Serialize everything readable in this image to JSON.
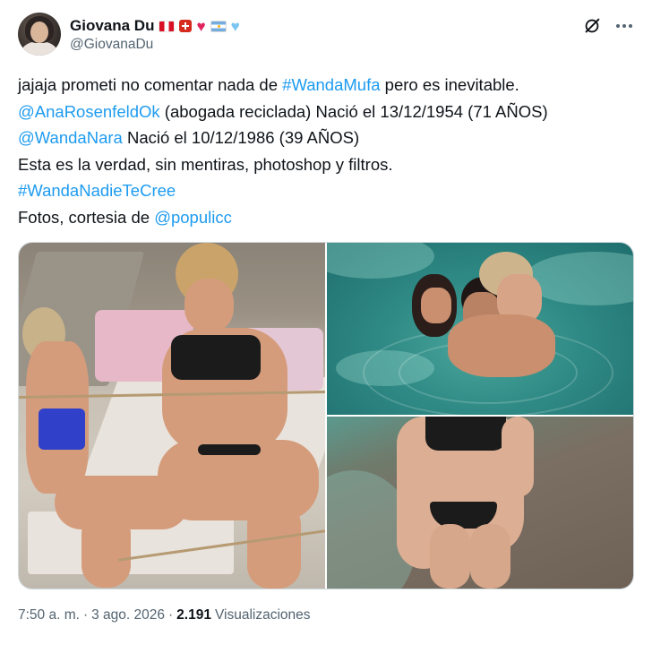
{
  "author": {
    "display_name": "Giovana Du",
    "handle": "@GiovanaDu",
    "name_emojis": [
      "flag-peru",
      "flag-switzerland",
      "red-heart",
      "flag-argentina",
      "light-blue-heart"
    ]
  },
  "tweet": {
    "lines": [
      {
        "parts": [
          {
            "text": "jajaja prometi no comentar nada de ",
            "link": false
          },
          {
            "text": "#WandaMufa",
            "link": true
          },
          {
            "text": " pero es inevitable.",
            "link": false
          }
        ]
      },
      {
        "parts": [
          {
            "text": "@AnaRosenfeldOk",
            "link": true
          },
          {
            "text": " (abogada reciclada) Nació el 13/12/1954 (71 AÑOS)",
            "link": false
          }
        ]
      },
      {
        "parts": [
          {
            "text": "@WandaNara",
            "link": true
          },
          {
            "text": " Nació el 10/12/1986 (39 AÑOS)",
            "link": false
          }
        ]
      },
      {
        "parts": [
          {
            "text": "Esta es la verdad, sin mentiras, photoshop y filtros.",
            "link": false
          }
        ]
      },
      {
        "parts": [
          {
            "text": "#WandaNadieTeCree",
            "link": true
          }
        ]
      },
      {
        "parts": [
          {
            "text": "Fotos, cortesia de ",
            "link": false
          },
          {
            "text": "@populicc",
            "link": true
          }
        ]
      }
    ]
  },
  "footer": {
    "time": "7:50 a. m.",
    "separator": "·",
    "date": "3 ago. 2026",
    "views_count": "2.191",
    "views_label": "Visualizaciones"
  },
  "colors": {
    "link": "#1d9bf0",
    "text": "#0f1419",
    "secondary": "#536471"
  }
}
